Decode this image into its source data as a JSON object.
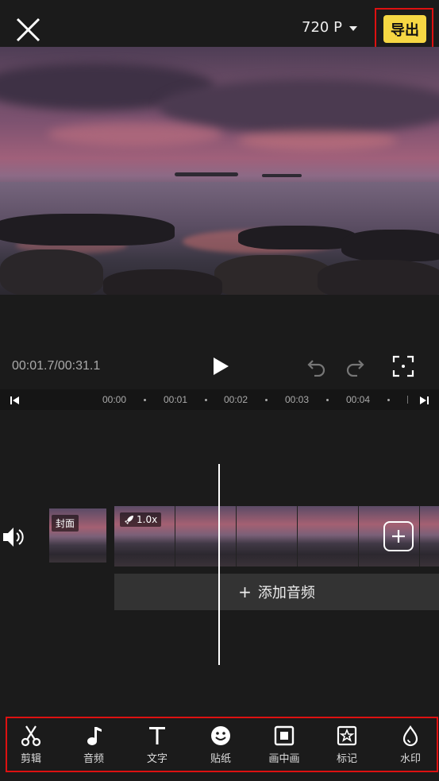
{
  "header": {
    "resolution": "720 P",
    "export_label": "导出"
  },
  "player": {
    "time_display": "00:01.7/00:31.1"
  },
  "ruler": {
    "ticks": [
      "00:00",
      "00:01",
      "00:02",
      "00:03",
      "00:04"
    ]
  },
  "timeline": {
    "cover_label": "封面",
    "speed_label": "1.0x",
    "add_audio_label": "添加音频"
  },
  "toolbar": {
    "items": [
      {
        "label": "剪辑",
        "icon": "scissors-icon"
      },
      {
        "label": "音频",
        "icon": "music-note-icon"
      },
      {
        "label": "文字",
        "icon": "text-icon"
      },
      {
        "label": "贴纸",
        "icon": "sticker-icon"
      },
      {
        "label": "画中画",
        "icon": "picture-in-picture-icon"
      },
      {
        "label": "标记",
        "icon": "star-mark-icon"
      },
      {
        "label": "水印",
        "icon": "watermark-drop-icon"
      }
    ]
  },
  "colors": {
    "accent": "#f6d743",
    "highlight_outline": "#dd1111",
    "background": "#1b1b1b"
  }
}
